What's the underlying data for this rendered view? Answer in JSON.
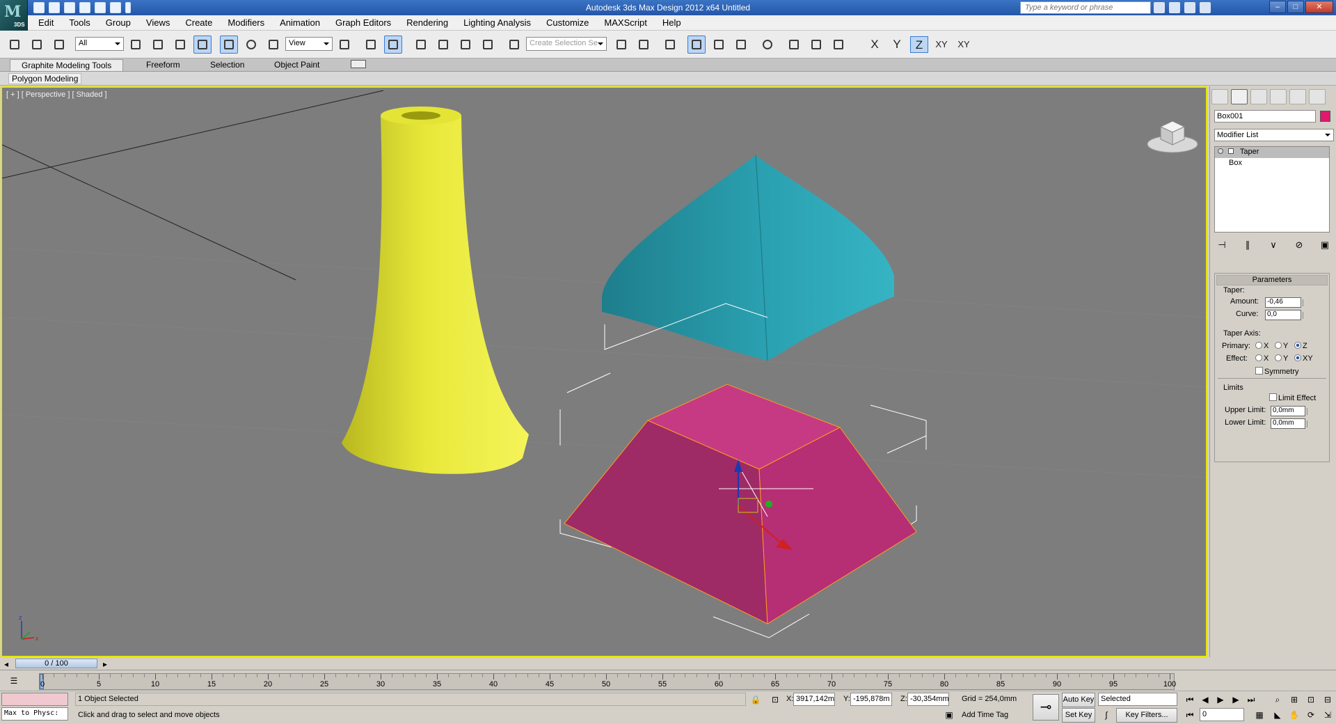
{
  "app": {
    "title": "Autodesk 3ds Max Design 2012 x64     Untitled",
    "logo_text": "3DS",
    "search_placeholder": "Type a keyword or phrase"
  },
  "menu": [
    "Edit",
    "Tools",
    "Group",
    "Views",
    "Create",
    "Modifiers",
    "Animation",
    "Graph Editors",
    "Rendering",
    "Lighting Analysis",
    "Customize",
    "MAXScript",
    "Help"
  ],
  "toolbar": {
    "filter_value": "All",
    "refcoord_value": "View",
    "selection_set_placeholder": "Create Selection Se",
    "axis_x": "X",
    "axis_y": "Y",
    "axis_z": "Z",
    "axis_xy": "XY",
    "axis_xy2": "XY"
  },
  "ribbon": {
    "tabs": [
      "Graphite Modeling Tools",
      "Freeform",
      "Selection",
      "Object Paint"
    ],
    "panel": "Polygon Modeling"
  },
  "viewport": {
    "label": "[ + ] [ Perspective ] [ Shaded ]",
    "colors": {
      "yellow": "#e8e83a",
      "teal": "#2aa0b0",
      "magenta": "#c0307a",
      "background": "#7d7d7d"
    }
  },
  "command_panel": {
    "object_name": "Box001",
    "object_color": "#e0186e",
    "modifier_list": "Modifier List",
    "stack": [
      "Taper",
      "Box"
    ],
    "rollout_title": "Parameters",
    "taper_label": "Taper:",
    "amount_label": "Amount:",
    "amount_value": "-0,46",
    "curve_label": "Curve:",
    "curve_value": "0,0",
    "taper_axis_label": "Taper Axis:",
    "primary_label": "Primary:",
    "effect_label": "Effect:",
    "primary_options": [
      "X",
      "Y",
      "Z"
    ],
    "primary_selected": "Z",
    "effect_options": [
      "X",
      "Y",
      "XY"
    ],
    "effect_selected": "XY",
    "symmetry_label": "Symmetry",
    "limits_label": "Limits",
    "limit_effect_label": "Limit Effect",
    "upper_limit_label": "Upper Limit:",
    "upper_limit_value": "0,0mm",
    "lower_limit_label": "Lower Limit:",
    "lower_limit_value": "0,0mm"
  },
  "time_slider": {
    "label": "0 / 100"
  },
  "timeline": {
    "ticks": [
      "0",
      "5",
      "10",
      "15",
      "20",
      "25",
      "30",
      "35",
      "40",
      "45",
      "50",
      "55",
      "60",
      "65",
      "70",
      "75",
      "80",
      "85",
      "90",
      "95",
      "100"
    ]
  },
  "status": {
    "maxscript": "Max to Physc:",
    "selection": "1 Object Selected",
    "prompt": "Click and drag to select and move objects",
    "x_label": "X:",
    "x_value": "3917,142m",
    "y_label": "Y:",
    "y_value": "-195,878m",
    "z_label": "Z:",
    "z_value": "-30,354mm",
    "grid": "Grid = 254,0mm",
    "add_time_tag": "Add Time Tag",
    "auto_key": "Auto Key",
    "set_key": "Set Key",
    "key_mode": "Selected",
    "key_filters": "Key Filters...",
    "frame": "0"
  }
}
